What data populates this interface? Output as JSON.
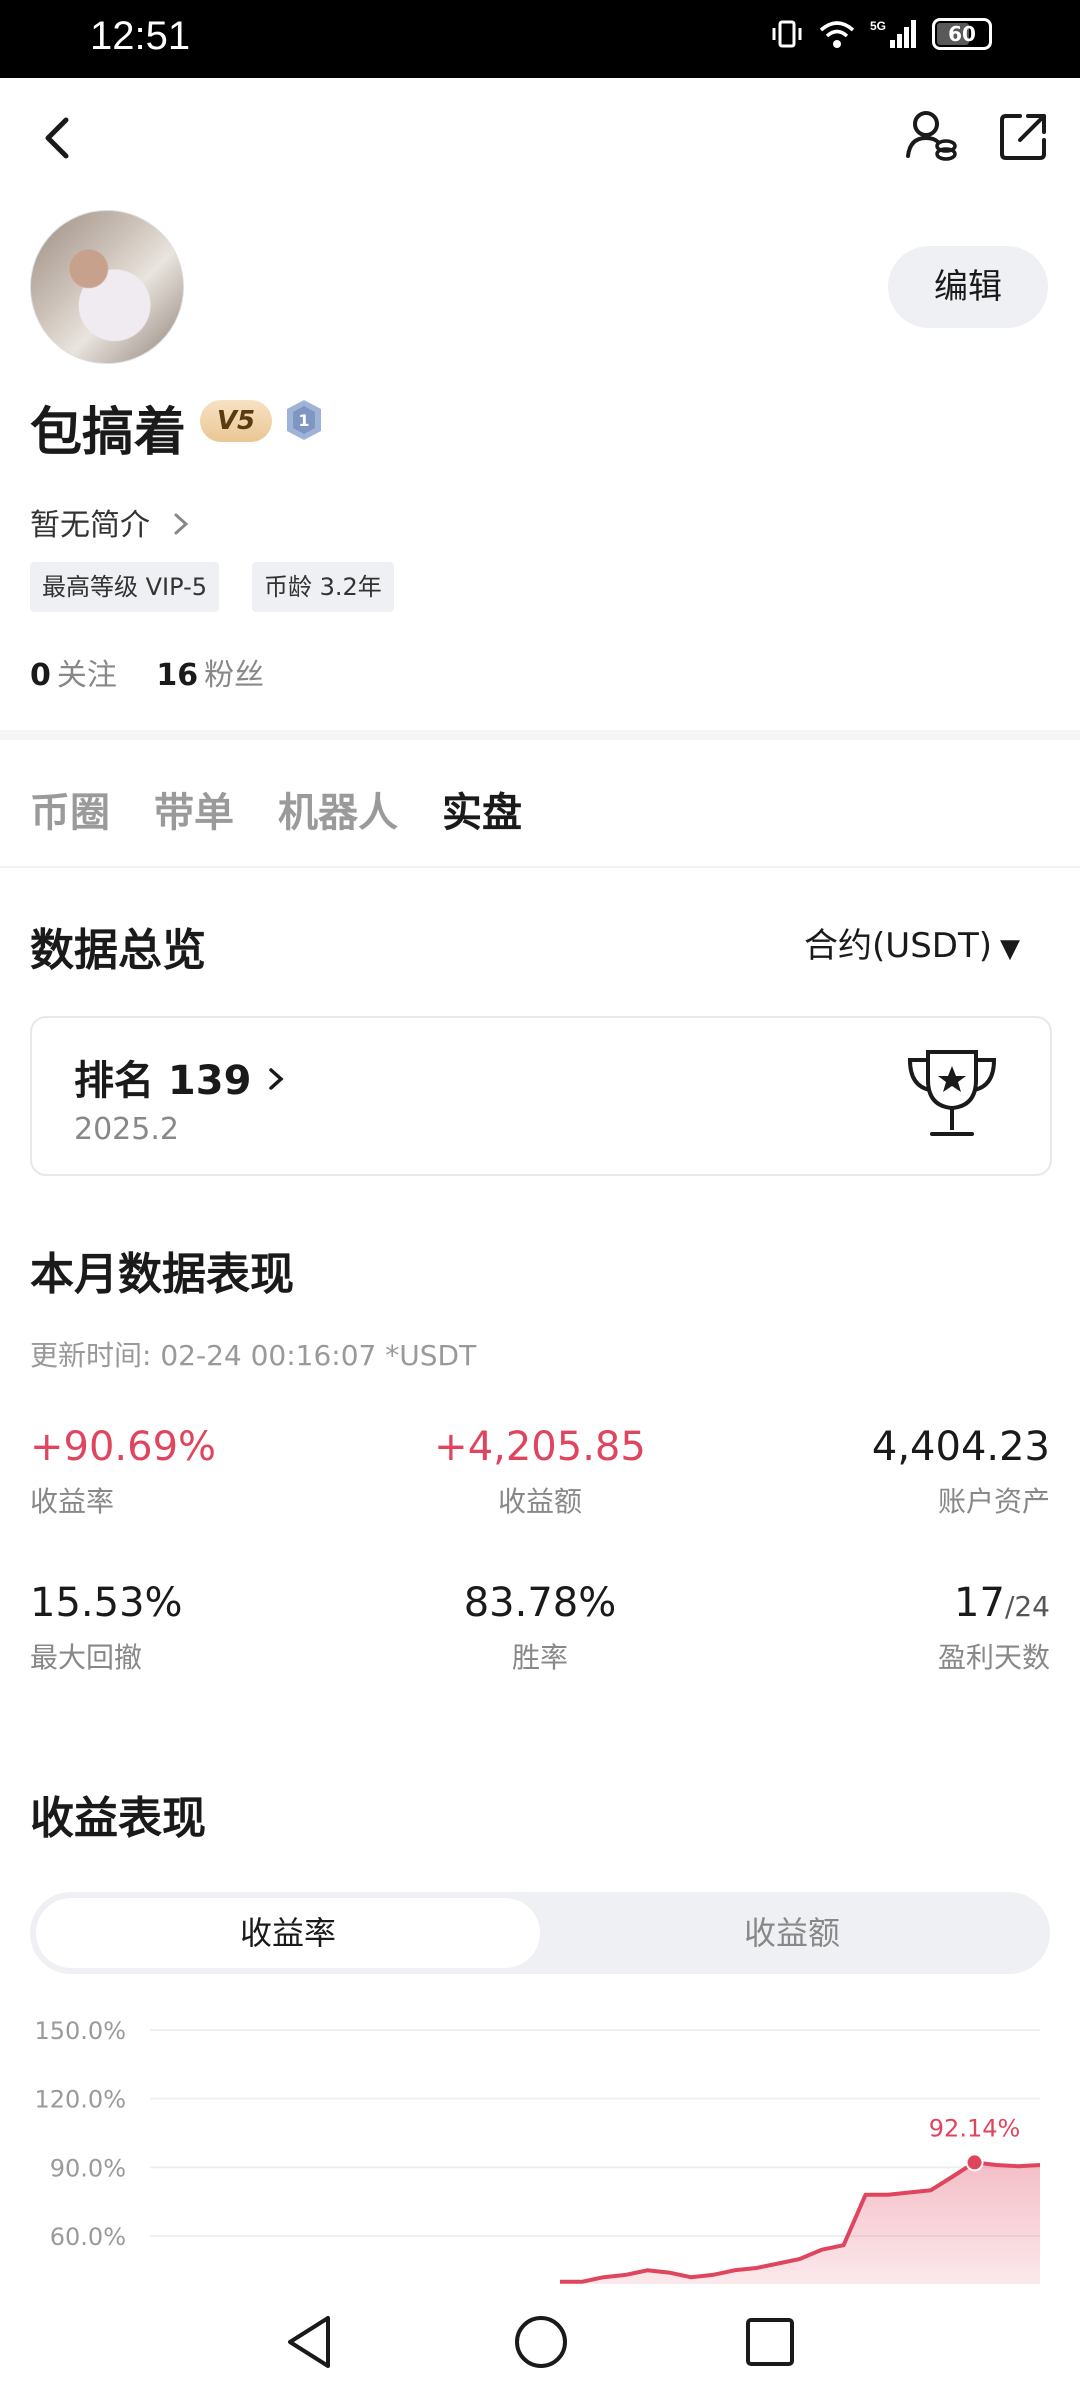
{
  "status_bar": {
    "time": "12:51",
    "battery": "60"
  },
  "profile": {
    "edit_label": "编辑",
    "username": "包搞着",
    "vip_badge": "V5",
    "level_badge": "1",
    "bio": "暂无简介",
    "tags": [
      "最高等级 VIP-5",
      "币龄 3.2年"
    ],
    "following_count": "0",
    "following_label": "关注",
    "followers_count": "16",
    "followers_label": "粉丝"
  },
  "tabs": [
    {
      "label": "币圈",
      "active": false
    },
    {
      "label": "带单",
      "active": false
    },
    {
      "label": "机器人",
      "active": false
    },
    {
      "label": "实盘",
      "active": true
    }
  ],
  "overview": {
    "title": "数据总览",
    "dropdown": "合约(USDT)",
    "rank_label": "排名 139",
    "rank_period": "2025.2"
  },
  "monthly": {
    "title": "本月数据表现",
    "update_label": "更新时间: 02-24 00:16:07  *USDT",
    "metrics": [
      {
        "value": "+90.69%",
        "label": "收益率"
      },
      {
        "value": "+4,205.85",
        "label": "收益额"
      },
      {
        "value": "4,404.23",
        "label": "账户资产"
      },
      {
        "value": "15.53%",
        "label": "最大回撤"
      },
      {
        "value": "83.78%",
        "label": "胜率"
      },
      {
        "value": "17",
        "value_suffix": "/24",
        "label": "盈利天数"
      }
    ]
  },
  "earnings": {
    "title": "收益表现",
    "segments": [
      "收益率",
      "收益额"
    ],
    "active_segment": "收益率"
  },
  "chart_data": {
    "type": "area",
    "y_ticks": [
      "150.0%",
      "120.0%",
      "90.0%",
      "60.0%"
    ],
    "ylim": [
      40,
      150
    ],
    "y": [
      40,
      40,
      42,
      43,
      45,
      44,
      42,
      43,
      45,
      46,
      48,
      50,
      54,
      56,
      78,
      78,
      79,
      80,
      86,
      92.14,
      91,
      90.5,
      91
    ],
    "peak_label": "92.14%",
    "grid": true,
    "color": "#e0455e"
  },
  "colors": {
    "accent_red": "#e0455e",
    "badge_gold": "#e9c793"
  }
}
